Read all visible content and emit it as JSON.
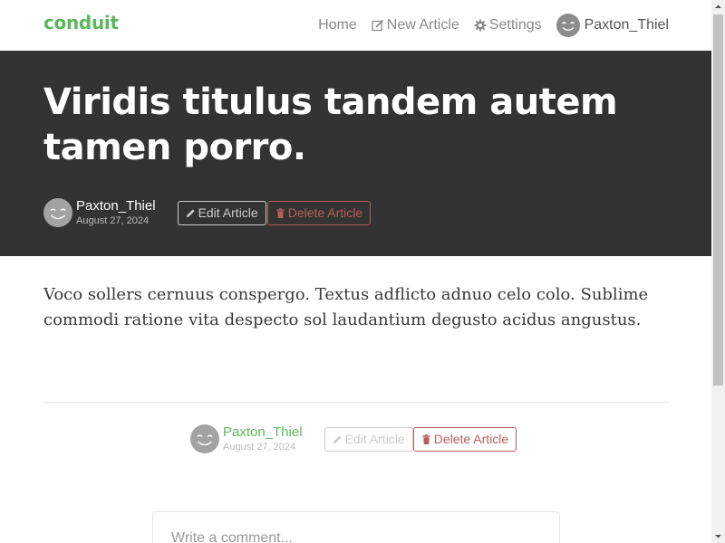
{
  "navbar": {
    "brand": "conduit",
    "links": {
      "home": "Home",
      "new_article": "New Article",
      "settings": "Settings",
      "user": "Paxton_Thiel"
    }
  },
  "article": {
    "title": "Viridis titulus tandem autem tamen porro.",
    "author": "Paxton_Thiel",
    "date": "August 27, 2024",
    "body": "Voco sollers cernuus conspergo. Textus adflicto adnuo celo colo. Sublime commodi ratione vita despecto sol laudantium degusto acidus angustus."
  },
  "actions": {
    "edit_label": "Edit Article",
    "delete_label": "Delete Article"
  },
  "comment": {
    "placeholder": "Write a comment..."
  },
  "colors": {
    "brand": "#5cb85c",
    "banner": "#333333",
    "danger": "#b85c5c"
  }
}
